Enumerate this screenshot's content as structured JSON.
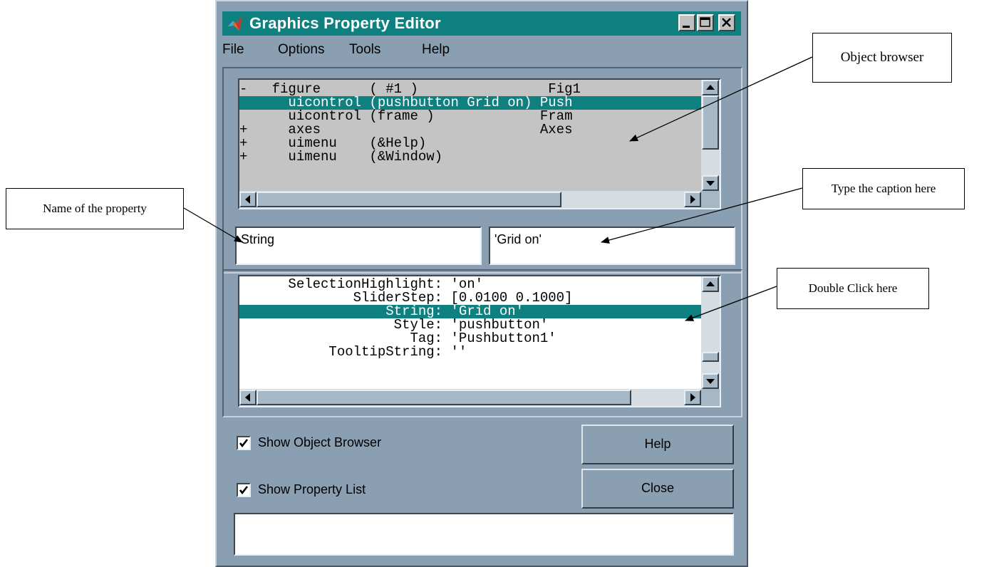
{
  "window": {
    "title": "Graphics Property Editor",
    "icon": "matlab-logo-icon"
  },
  "menu": [
    "File",
    "Options",
    "Tools",
    "Help"
  ],
  "object_browser": {
    "rows": [
      "-   figure      ( #1 )                Fig1",
      "      uicontrol (pushbutton Grid on) Push",
      "      uicontrol (frame )             Fram",
      "+     axes                           Axes",
      "+     uimenu    (&Help)",
      "+     uimenu    (&Window)"
    ],
    "selected_index": 1
  },
  "property_name_field": "String",
  "property_value_field": "'Grid on'",
  "property_list": {
    "rows": [
      "      SelectionHighlight: 'on'",
      "              SliderStep: [0.0100 0.1000]",
      "                  String: 'Grid on'",
      "                   Style: 'pushbutton'",
      "                     Tag: 'Pushbutton1'",
      "           TooltipString: ''"
    ],
    "selected_index": 2
  },
  "options": {
    "show_object_browser": {
      "label": "Show Object Browser",
      "checked": true
    },
    "show_property_list": {
      "label": "Show Property List",
      "checked": true
    }
  },
  "buttons": {
    "help": "Help",
    "close": "Close"
  },
  "status_text": "",
  "annotations": {
    "object_browser": "Object browser",
    "caption": "Type the caption here",
    "double_click": "Double Click here",
    "property_name": "Name of the property"
  },
  "colors": {
    "selection": "#0f8080",
    "titlebar": "#0f8080",
    "window_bg": "#8a9fb2"
  }
}
